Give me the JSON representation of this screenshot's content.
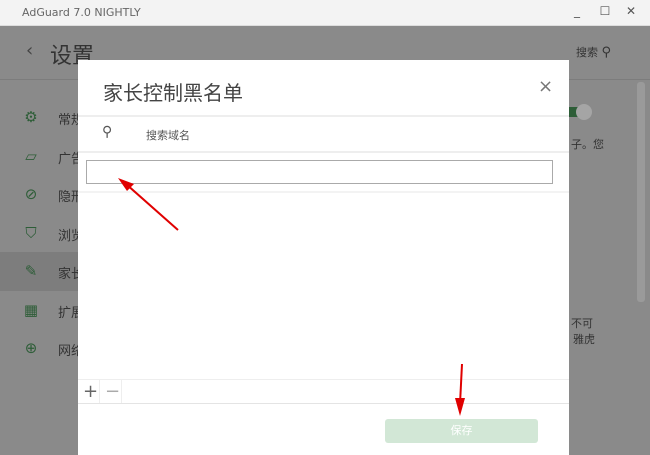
{
  "window": {
    "title": "AdGuard 7.0 NIGHTLY",
    "minimize": "_",
    "maximize": "☐",
    "close": "✕"
  },
  "header": {
    "back": "‹",
    "title": "设置",
    "search_label": "搜索"
  },
  "sidebar": {
    "items": [
      {
        "label": "常规",
        "icon": "gear-icon",
        "glyph": "⚙"
      },
      {
        "label": "广告",
        "icon": "ad-block-icon",
        "glyph": "▱"
      },
      {
        "label": "隐形",
        "icon": "stealth-eye-icon",
        "glyph": "⊘"
      },
      {
        "label": "浏览",
        "icon": "shield-icon",
        "glyph": "⛉"
      },
      {
        "label": "家长",
        "icon": "parental-icon",
        "glyph": "✎"
      },
      {
        "label": "扩展",
        "icon": "extensions-grid-icon",
        "glyph": "▦"
      },
      {
        "label": "网络",
        "icon": "globe-icon",
        "glyph": "⊕"
      }
    ],
    "selected": 4
  },
  "background_text": {
    "line1": "子。您",
    "line2": "不可",
    "line3": "雅虎"
  },
  "dialog": {
    "title": "家长控制黑名单",
    "close": "×",
    "search_placeholder": "搜索域名",
    "input_value": "",
    "add": "+",
    "remove": "−",
    "save": "保存"
  },
  "colors": {
    "accent": "#2d7d3f",
    "save_disabled": "#d2e7d6",
    "annotation_arrow": "#e00000"
  }
}
